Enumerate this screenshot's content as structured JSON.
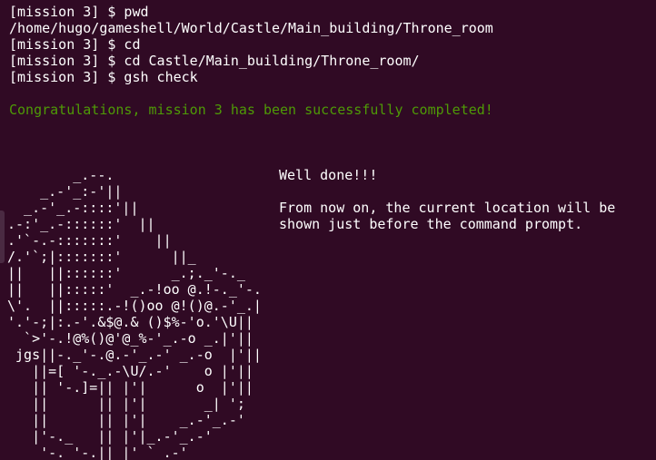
{
  "terminal": {
    "lines": [
      "[mission 3] $ pwd",
      "/home/hugo/gameshell/World/Castle/Main_building/Throne_room",
      "[mission 3] $ cd",
      "[mission 3] $ cd Castle/Main_building/Throne_room/",
      "[mission 3] $ gsh check"
    ],
    "success_message": "Congratulations, mission 3 has been successfully completed!",
    "ascii_art": "        _.--.\n    _.-'_:-'||\n  _.-'_.-::::'||\n.-:'_.-::::::'  ||\n.'`-.-:::::::'    ||\n/.'`;|:::::::'      ||_\n||   ||::::::'      _.;._'-._\n||   ||:::::'  _.-!oo @.!-._'-.\n\\'.  ||:::::.-!()oo @!()@.-'_.|\n'.'-;|:.-'.&$@.& ()$%-'o.'\\U||\n  `>'-.!@%()@'@_%-'_.-o _.|'||\n jgs||-._'-.@.-'_.-' _.-o  |'||\n   ||=[ '-._.-\\U/.-'    o |'||\n   || '-.]=|| |'|      o  |'||\n   ||      || |'|       _| ';\n   ||      || |'|    _.-'_.-'\n   |'-._   || |'|_.-'_.-'\n    '-._'-.|| |' `_.-'",
    "praise": "Well done!!!",
    "info_line_1": "From now on, the current location will be",
    "info_line_2": "shown just before the command prompt.",
    "colors": {
      "background": "#300a24",
      "foreground": "#ffffff",
      "success": "#4e9a06"
    }
  }
}
